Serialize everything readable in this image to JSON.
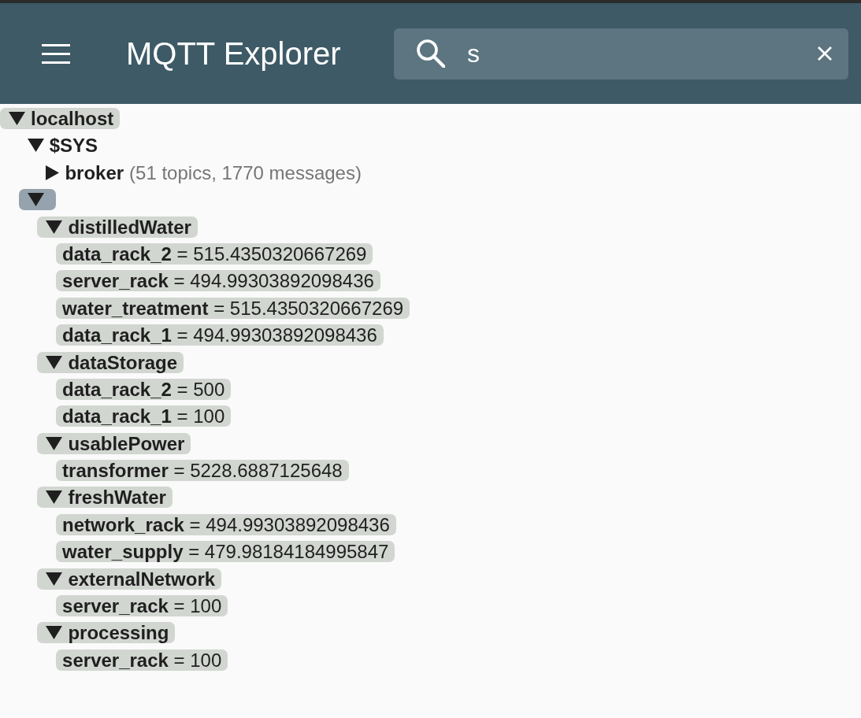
{
  "header": {
    "title": "MQTT Explorer"
  },
  "search": {
    "value": "s"
  },
  "tree": [
    {
      "kind": "branch",
      "name": "localhost",
      "expanded": true,
      "selected": false,
      "highlighted": true,
      "children": [
        {
          "kind": "branch",
          "name": "$SYS",
          "expanded": true,
          "selected": false,
          "highlighted": false,
          "children": [
            {
              "kind": "branch",
              "name": "broker",
              "summary": "(51 topics, 1770 messages)",
              "expanded": false,
              "selected": false,
              "highlighted": false
            }
          ]
        },
        {
          "kind": "branch",
          "expanded": true,
          "selected": true,
          "highlighted": true,
          "children": [
            {
              "kind": "branch",
              "name": "distilledWater",
              "expanded": true,
              "selected": false,
              "highlighted": true,
              "children": [
                {
                  "kind": "leaf",
                  "text": "**data_rack_2** = 515.4350320667269",
                  "selected": false,
                  "highlighted": true
                },
                {
                  "kind": "leaf",
                  "text": "**server_rack** = 494.99303892098436",
                  "selected": false,
                  "highlighted": true
                },
                {
                  "kind": "leaf",
                  "text": "**water_treatment** = 515.4350320667269",
                  "selected": false,
                  "highlighted": true
                },
                {
                  "kind": "leaf",
                  "text": "**data_rack_1** = 494.99303892098436",
                  "selected": false,
                  "highlighted": true
                }
              ]
            },
            {
              "kind": "branch",
              "name": "dataStorage",
              "expanded": true,
              "selected": false,
              "highlighted": true,
              "children": [
                {
                  "kind": "leaf",
                  "text": "**data_rack_2** = 500",
                  "selected": false,
                  "highlighted": true
                },
                {
                  "kind": "leaf",
                  "text": "**data_rack_1** = 100",
                  "selected": false,
                  "highlighted": true
                }
              ]
            },
            {
              "kind": "branch",
              "name": "usablePower",
              "expanded": true,
              "selected": false,
              "highlighted": true,
              "children": [
                {
                  "kind": "leaf",
                  "text": "**transformer** = 5228.6887125648",
                  "selected": false,
                  "highlighted": true
                }
              ]
            },
            {
              "kind": "branch",
              "name": "freshWater",
              "expanded": true,
              "selected": false,
              "highlighted": true,
              "children": [
                {
                  "kind": "leaf",
                  "text": "**network_rack** = 494.99303892098436",
                  "selected": false,
                  "highlighted": true
                },
                {
                  "kind": "leaf",
                  "text": "**water_supply** = 479.98184184995847",
                  "selected": false,
                  "highlighted": true
                }
              ]
            },
            {
              "kind": "branch",
              "name": "externalNetwork",
              "expanded": true,
              "selected": false,
              "highlighted": true,
              "children": [
                {
                  "kind": "leaf",
                  "text": "**server_rack** = 100",
                  "selected": false,
                  "highlighted": true
                }
              ]
            },
            {
              "kind": "branch",
              "name": "processing",
              "expanded": true,
              "selected": false,
              "highlighted": true,
              "children": [
                {
                  "kind": "leaf",
                  "text": "**server_rack** = 100",
                  "selected": false,
                  "highlighted": true
                }
              ]
            }
          ]
        }
      ]
    }
  ]
}
